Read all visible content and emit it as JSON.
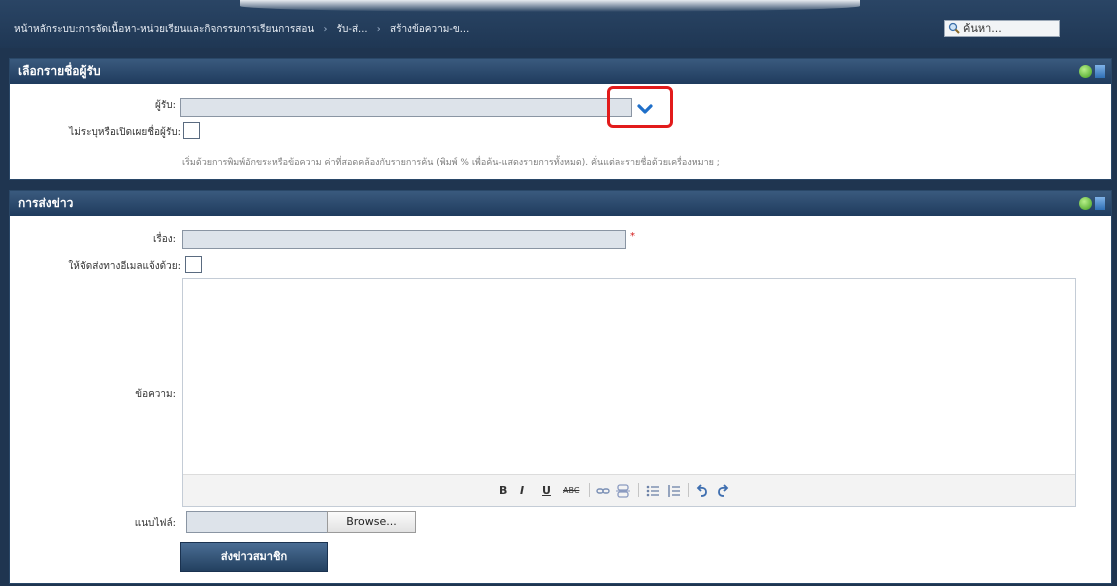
{
  "breadcrumb": {
    "items": [
      "หน้าหลักระบบ:การจัดเนื้อหา-หน่วยเรียนและกิจกรรมการเรียนการสอน",
      "รับ-ส่...",
      "สร้างข้อความ-ข..."
    ]
  },
  "search": {
    "label": "ค้นหา..."
  },
  "recipients_panel": {
    "title": "เลือกรายชื่อผู้รับ",
    "recipient_label": "ผู้รับ:",
    "hide_recipients_label": "ไม่ระบุหรือเปิดเผยชื่อผู้รับ:",
    "hint": "เริ่มด้วยการพิมพ์อักขระหรือข้อความ ค่าที่สอดคล้องกับรายการค้น (พิมพ์ % เพื่อค้น-แสดงรายการทั้งหมด). คั่นแต่ละรายชื่อด้วยเครื่องหมาย ;"
  },
  "message_panel": {
    "title": "การส่งข่าว",
    "subject_label": "เรื่อง:",
    "required_marker": "*",
    "email_label": "ให้จัดส่งทางอีเมลแจ้งด้วย:",
    "message_label": "ข้อความ:",
    "toolbar": {
      "bold": "B",
      "italic": "I",
      "underline": "U",
      "strike": "ABC"
    },
    "attachment_label": "แนบไฟล์:",
    "browse_label": "Browse...",
    "submit_label": "ส่งข่าวสมาชิก"
  },
  "colors": {
    "accent": "#1f6fc9",
    "highlight": "#e21b1b",
    "header": "#1f3b5d"
  }
}
